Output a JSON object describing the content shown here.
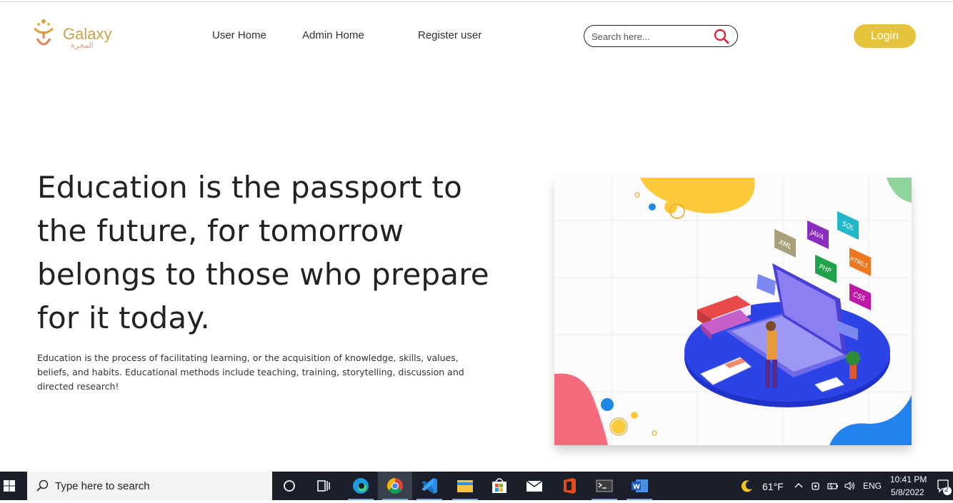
{
  "brand": {
    "name": "Galaxy",
    "subtitle": "المجرة"
  },
  "nav": {
    "user_home": "User Home",
    "admin_home": "Admin Home",
    "register_user": "Register user"
  },
  "search": {
    "placeholder": "Search here..."
  },
  "login_label": "Login",
  "hero": {
    "title": "Education is the passport to the future, for tomorrow belongs to those who prepare for it today.",
    "description": "Education is the process of facilitating learning, or the acquisition of knowledge, skills, values, beliefs, and habits. Educational methods include teaching, training, storytelling, discussion and directed research!"
  },
  "illustration": {
    "tags": [
      "XML",
      "JAVA",
      "SQL",
      "PHP",
      "HTML5",
      "CSS"
    ]
  },
  "taskbar": {
    "search_placeholder": "Type here to search",
    "weather": "61°F",
    "language": "ENG",
    "time": "10:41 PM",
    "date": "5/8/2022",
    "notification_count": "2"
  },
  "colors": {
    "login": "#e5c33a",
    "search_icon": "#e0263a",
    "brand": "#c9a24a"
  }
}
